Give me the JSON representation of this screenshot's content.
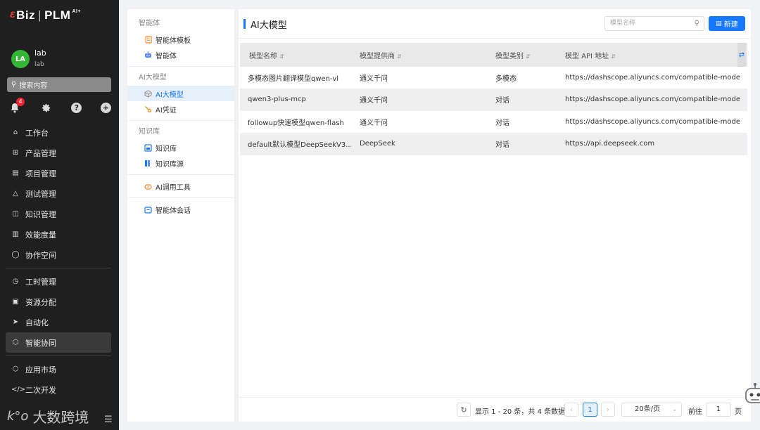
{
  "brand": {
    "prefix": "ɛ",
    "name": "Biz",
    "separator": "|",
    "product": "PLM",
    "super": "AI+"
  },
  "user": {
    "initials": "LA",
    "name": "lab",
    "sub": "lab"
  },
  "sidebar_search": {
    "placeholder": "搜索内容"
  },
  "quick_actions": {
    "notification_count": "4",
    "help_glyph": "?",
    "add_glyph": "+"
  },
  "nav": {
    "group1": [
      {
        "label": "工作台",
        "icon": "home-icon"
      },
      {
        "label": "产品管理",
        "icon": "grid-icon"
      },
      {
        "label": "项目管理",
        "icon": "folder-icon"
      },
      {
        "label": "测试管理",
        "icon": "flask-icon"
      },
      {
        "label": "知识管理",
        "icon": "book-icon"
      },
      {
        "label": "效能度量",
        "icon": "chart-icon"
      },
      {
        "label": "协作空间",
        "icon": "chat-icon"
      }
    ],
    "group2": [
      {
        "label": "工时管理",
        "icon": "clock-icon"
      },
      {
        "label": "资源分配",
        "icon": "resource-icon"
      },
      {
        "label": "自动化",
        "icon": "rocket-icon"
      },
      {
        "label": "智能协同",
        "icon": "ai-icon",
        "active": true
      }
    ],
    "group3": [
      {
        "label": "应用市场",
        "icon": "cube-icon"
      },
      {
        "label": "二次开发",
        "icon": "code-icon"
      }
    ]
  },
  "watermark": {
    "text": "大数跨境",
    "logo": "k°o"
  },
  "submenu": {
    "agent_group": "智能体",
    "agent_template": "智能体模板",
    "agent": "智能体",
    "model_group": "AI大模型",
    "model": "AI大模型",
    "credential": "AI凭证",
    "kb_group": "知识库",
    "kb": "知识库",
    "kb_source": "知识库源",
    "tools": "AI调用工具",
    "chat": "智能体会话"
  },
  "main": {
    "title": "AI大模型",
    "search_placeholder": "模型名称",
    "new_label": "新建"
  },
  "table": {
    "columns": [
      "模型名称",
      "模型提供商",
      "模型类别",
      "模型 API 地址"
    ],
    "rows": [
      [
        "多模态图片翻译模型qwen-vl",
        "通义千问",
        "多模态",
        "https://dashscope.aliyuncs.com/compatible-mode"
      ],
      [
        "qwen3-plus-mcp",
        "通义千问",
        "对话",
        "https://dashscope.aliyuncs.com/compatible-mode"
      ],
      [
        "followup快速模型qwen-flash",
        "通义千问",
        "对话",
        "https://dashscope.aliyuncs.com/compatible-mode"
      ],
      [
        "default默认模型DeepSeekV3....",
        "DeepSeek",
        "对话",
        "https://api.deepseek.com"
      ]
    ]
  },
  "pagination": {
    "summary": "显示 1 - 20 条，共 4 条数据",
    "current_page": "1",
    "page_size": "20条/页",
    "goto_label": "前往",
    "goto_value": "1",
    "unit": "页"
  },
  "colors": {
    "accent": "#1677ff",
    "sidebar_bg": "#1f1f1f",
    "avatar": "#35b535",
    "badge": "#f5222d"
  }
}
